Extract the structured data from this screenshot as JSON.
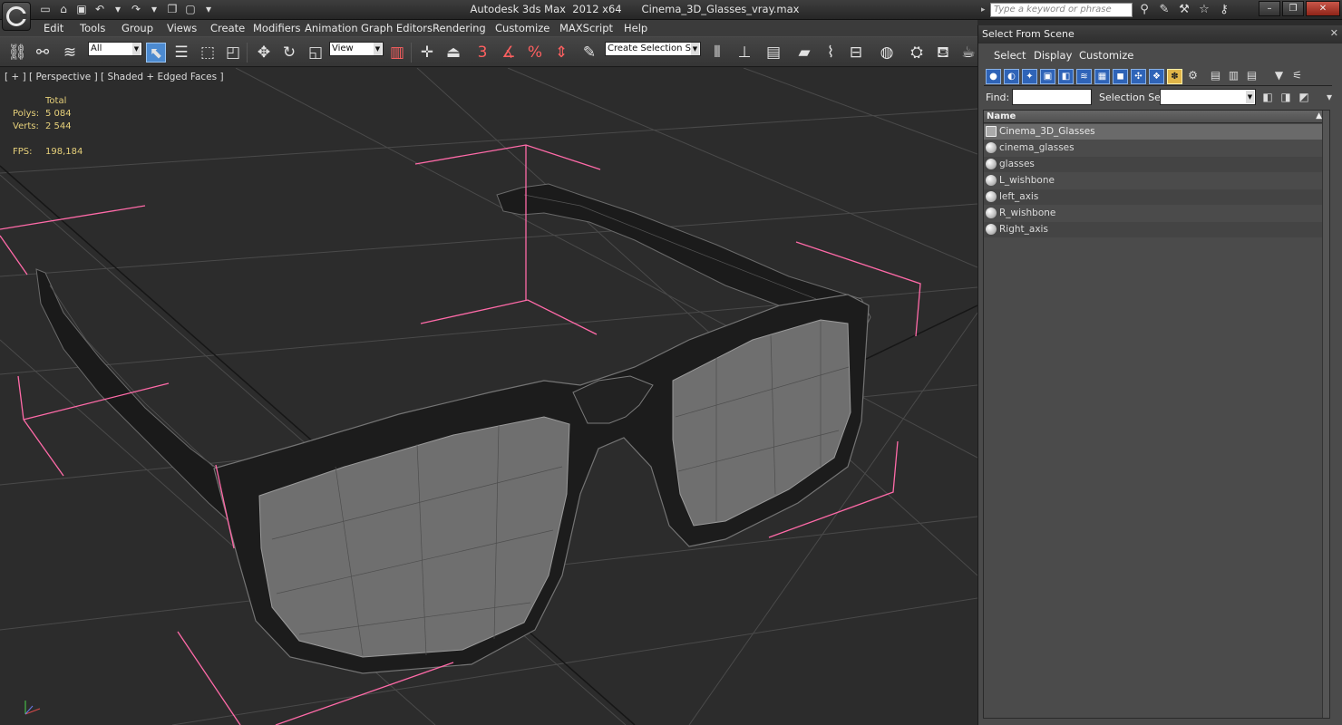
{
  "window": {
    "title": "Autodesk 3ds Max  2012 x64      Cinema_3D_Glasses_vray.max",
    "search_placeholder": "Type a keyword or phrase"
  },
  "menu": [
    "Edit",
    "Tools",
    "Group",
    "Views",
    "Create",
    "Modifiers",
    "Animation",
    "Graph Editors",
    "Rendering",
    "Customize",
    "MAXScript",
    "Help"
  ],
  "toolbar": {
    "selection_filter": "All",
    "reference_coord": "View",
    "named_selection": "Create Selection Se"
  },
  "viewport": {
    "label": "[ + ] [ Perspective ] [ Shaded + Edged Faces ]",
    "stats": {
      "header": "Total",
      "polys_label": "Polys:",
      "polys_value": "5 084",
      "verts_label": "Verts:",
      "verts_value": "2 544",
      "fps_label": "FPS:",
      "fps_value": "198,184"
    }
  },
  "panel": {
    "title": "Select From Scene",
    "menu": [
      "Select",
      "Display",
      "Customize"
    ],
    "find_label": "Find:",
    "selection_set_label": "Selection Set:",
    "column_name": "Name",
    "items": [
      {
        "name": "Cinema_3D_Glasses",
        "icon": "group-icon"
      },
      {
        "name": "cinema_glasses",
        "icon": "sphere-icon"
      },
      {
        "name": "glasses",
        "icon": "sphere-icon"
      },
      {
        "name": "L_wishbone",
        "icon": "sphere-icon"
      },
      {
        "name": "left_axis",
        "icon": "sphere-icon"
      },
      {
        "name": "R_wishbone",
        "icon": "sphere-icon"
      },
      {
        "name": "Right_axis",
        "icon": "sphere-icon"
      }
    ]
  },
  "colors": {
    "selection_bracket": "#ff6aa8",
    "stats_text": "#e6d07a",
    "active_tool": "#4c8ad0"
  }
}
